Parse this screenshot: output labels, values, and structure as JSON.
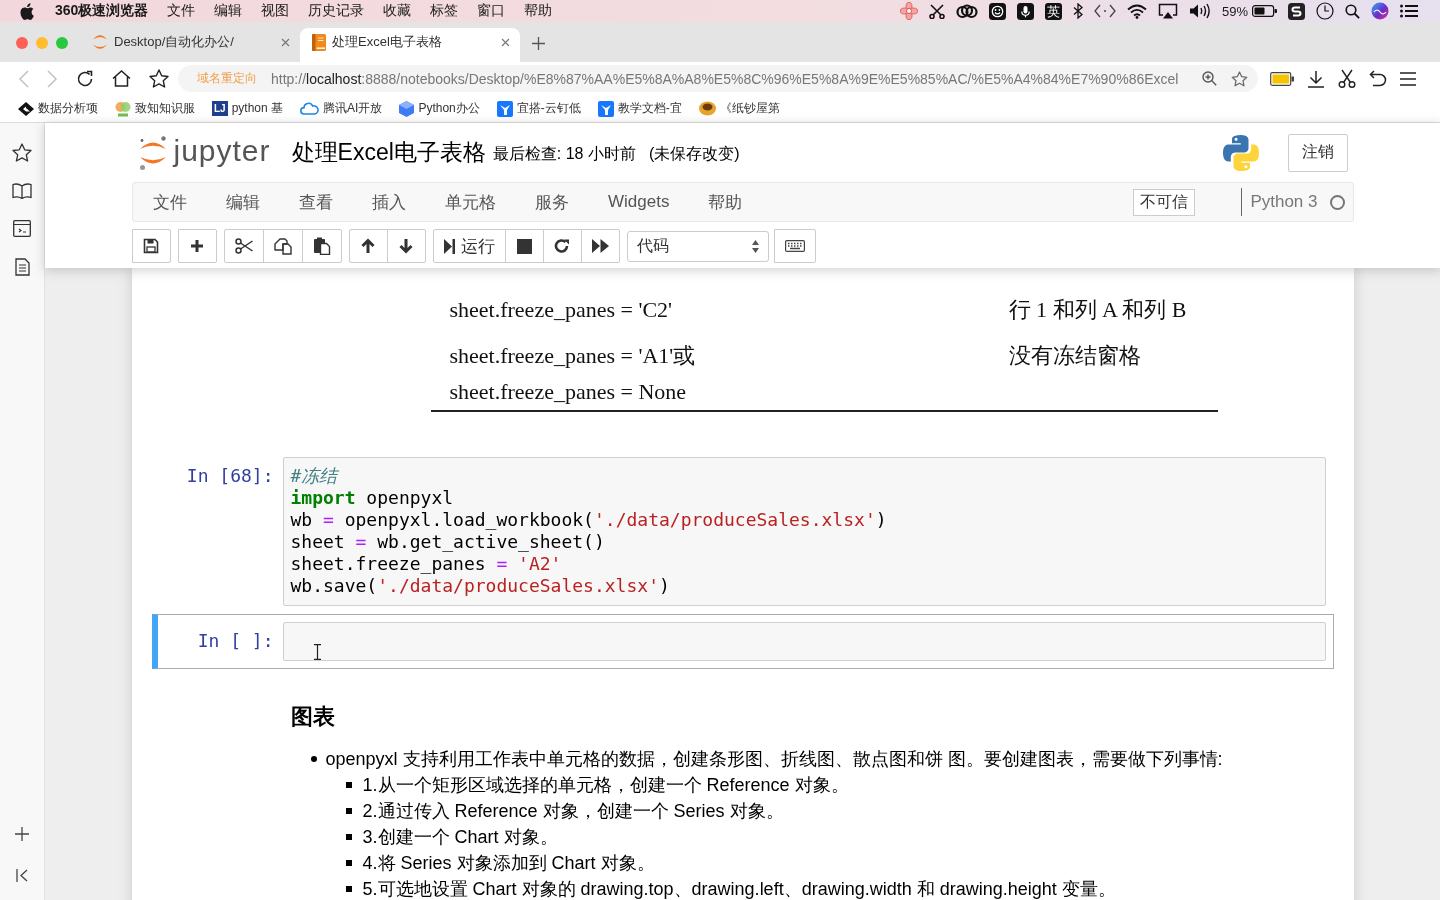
{
  "menu_bar": {
    "app_name": "360极速浏览器",
    "items": [
      "文件",
      "编辑",
      "视图",
      "历史记录",
      "收藏",
      "标签",
      "窗口",
      "帮助"
    ],
    "input_method": "英",
    "battery": "59%"
  },
  "browser": {
    "tabs": [
      {
        "title": "Desktop/自动化办公/",
        "kind": "arcs",
        "selected": false
      },
      {
        "title": "处理Excel电子表格",
        "kind": "book",
        "selected": true
      }
    ],
    "address_bar": {
      "badge": "域名重定向",
      "url": {
        "scheme": "http://",
        "host": "localhost",
        "path": ":8888/notebooks/Desktop/%E8%87%AA%E5%8A%A8%E5%8C%96%E5%8A%9E%E5%85%AC/%E5%A4%84%E7%90%86Excel"
      }
    },
    "bookmarks": [
      {
        "label": "数据分析项",
        "kind": "diamond"
      },
      {
        "label": "致知知识服",
        "kind": "circles"
      },
      {
        "label": "python 基",
        "kind": "letters",
        "icon_text": "LJ"
      },
      {
        "label": "腾讯AI开放",
        "kind": "cloud"
      },
      {
        "label": "Python办公",
        "kind": "cube"
      },
      {
        "label": "宜搭-云钉低",
        "kind": "ding"
      },
      {
        "label": "教学文档-宜",
        "kind": "ding"
      },
      {
        "label": "《纸钞屋第",
        "kind": "orb"
      }
    ]
  },
  "notebook": {
    "logo_text": "jupyter",
    "title": "处理Excel电子表格",
    "checkpoint": "最后检查: 18 小时前",
    "save_status": "(未保存改变)",
    "logout": "注销",
    "menus": [
      "文件",
      "编辑",
      "查看",
      "插入",
      "单元格",
      "服务",
      "Widgets",
      "帮助"
    ],
    "trust": "不可信",
    "kernel": "Python 3",
    "kernel_busy": false,
    "run_label": "运行",
    "cell_type": "代码"
  },
  "cells": [
    {
      "kind": "table",
      "rows": [
        {
          "code": [
            "sheet.freeze_panes = 'C2'"
          ],
          "effect": "行 1 和列 A 和列 B"
        },
        {
          "code": [
            "sheet.freeze_panes = 'A1'或",
            "sheet.freeze_panes = None"
          ],
          "effect": "没有冻结窗格"
        }
      ]
    },
    {
      "kind": "code",
      "prompt": "In [68]:",
      "selected": false,
      "lines": [
        [
          {
            "kind": "comment",
            "text": "#冻结"
          }
        ],
        [
          {
            "kind": "keyword",
            "text": "import"
          },
          {
            "kind": "plain",
            "text": " openpyxl"
          }
        ],
        [
          {
            "kind": "plain",
            "text": "wb "
          },
          {
            "kind": "operator",
            "text": "="
          },
          {
            "kind": "plain",
            "text": " openpyxl.load_workbook("
          },
          {
            "kind": "string",
            "text": "'./data/produceSales.xlsx'"
          },
          {
            "kind": "plain",
            "text": ")"
          }
        ],
        [
          {
            "kind": "plain",
            "text": "sheet "
          },
          {
            "kind": "operator",
            "text": "="
          },
          {
            "kind": "plain",
            "text": " wb.get_active_sheet()"
          }
        ],
        [
          {
            "kind": "plain",
            "text": "sheet.freeze_panes "
          },
          {
            "kind": "operator",
            "text": "="
          },
          {
            "kind": "string",
            "text": " 'A2'"
          }
        ],
        [
          {
            "kind": "plain",
            "text": "wb.save("
          },
          {
            "kind": "string",
            "text": "'./data/produceSales.xlsx'"
          },
          {
            "kind": "plain",
            "text": ")"
          }
        ]
      ]
    },
    {
      "kind": "code",
      "prompt": "In [ ]:",
      "selected": true
    },
    {
      "kind": "markdown",
      "heading": "图表",
      "bullets": [
        {
          "text": "openpyxl 支持利用工作表中单元格的数据，创建条形图、折线图、散点图和饼 图。要创建图表，需要做下列事情:",
          "children": [
            {
              "text": "1.从一个矩形区域选择的单元格，创建一个 Reference 对象。"
            },
            {
              "text": "2.通过传入 Reference 对象，创建一个 Series 对象。"
            },
            {
              "text": "3.创建一个 Chart 对象。"
            },
            {
              "text": "4.将 Series 对象添加到 Chart 对象。"
            },
            {
              "text": "5.可选地设置 Chart 对象的 drawing.top、drawing.left、drawing.width 和 drawing.height 变量。"
            }
          ]
        }
      ]
    }
  ]
}
